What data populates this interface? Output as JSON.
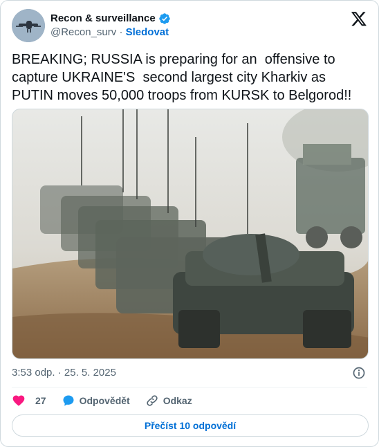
{
  "account": {
    "display_name": "Recon & surveillance",
    "handle": "@Recon_surv",
    "separator": " · ",
    "follow_label": "Sledovat"
  },
  "tweet": {
    "text": "BREAKING; RUSSIA is preparing for an  offensive to capture UKRAINE'S  second largest city Kharkiv as PUTIN moves 50,000 troops from KURSK to Belgorod!!",
    "timestamp": "3:53 odp. · 25. 5. 2025"
  },
  "media": {
    "description_icon": "photo-of-tanks-column"
  },
  "actions": {
    "like_count": "27",
    "reply_label": "Odpovědět",
    "link_label": "Odkaz"
  },
  "footer": {
    "read_replies_label": "Přečíst 10 odpovědí"
  },
  "colors": {
    "accent": "#006fd6",
    "verified": "#1d9bf0",
    "like": "#f91880",
    "muted": "#536471",
    "border": "#cfd9de"
  }
}
